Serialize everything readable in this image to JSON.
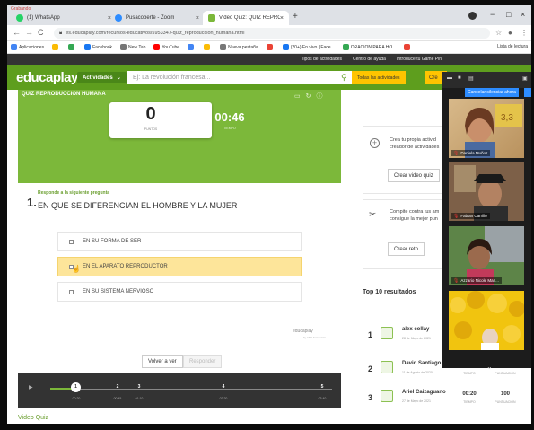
{
  "browser": {
    "recording_label": "Grabando",
    "tabs": [
      {
        "title": "(1) WhatsApp",
        "favicon_color": "#25d366"
      },
      {
        "title": "Pusacoberte - Zoom",
        "favicon_color": "#2d8cff"
      },
      {
        "title": "Video Quiz: QUIZ REPRODUCCIÓN",
        "favicon_color": "#7cb83a"
      }
    ],
    "new_tab": "+",
    "url": "es.educaplay.com/recursos-educativos/5953347-quiz_reproduccion_humana.html",
    "window_controls": [
      "−",
      "□",
      "×"
    ],
    "bookmarks": [
      {
        "label": "Aplicaciones",
        "color": "#4285f4"
      },
      {
        "label": "",
        "color": "#fbbc05"
      },
      {
        "label": "",
        "color": "#34a853"
      },
      {
        "label": "Facebook",
        "color": "#1877f2"
      },
      {
        "label": "New Tab",
        "color": "#777777"
      },
      {
        "label": "YouTube",
        "color": "#ff0000"
      },
      {
        "label": "",
        "color": "#4285f4"
      },
      {
        "label": "",
        "color": "#fbbc05"
      },
      {
        "label": "Nueva pestaña",
        "color": "#777777"
      },
      {
        "label": "",
        "color": "#ea4335"
      },
      {
        "label": "(20+) En vivo | Face...",
        "color": "#1877f2"
      },
      {
        "label": "ORACION PARA HO...",
        "color": "#34a853"
      },
      {
        "label": "",
        "color": "#ea4335"
      }
    ],
    "reading_list": "Lista de lectura"
  },
  "site": {
    "top_links": [
      "Tipos de actividades",
      "Centro de ayuda",
      "Introduce tu Game Pin"
    ],
    "logo": "educaplay",
    "activities_btn": "Actividades",
    "search_placeholder": "Ej: La revolución francesa...",
    "all_activities": "Todas las actividades",
    "create_btn": "Cre",
    "brand_green": "#5e9e1e",
    "accent_yellow": "#ffc400"
  },
  "quiz": {
    "title": "QUIZ REPRODUCCION HUMANA",
    "score": "0",
    "score_label": "PUNTOS",
    "time": "00:46",
    "time_label": "TIEMPO",
    "instruction": "Responde a la siguiente pregunta",
    "question_number": "1.",
    "question": "EN QUE SE DIFERENCIAN EL HOMBRE Y LA MUJER",
    "options": [
      "EN SU FORMA DE SER",
      "EN EL APARATO REPRODUCTOR",
      "EN SU SISTEMA NERVIOSO"
    ],
    "hovered_option": 1,
    "branding": "educaplay",
    "branding_sub": "by ADN Formación",
    "back_btn": "Volver a ver",
    "reply_btn": "Responder",
    "timeline_marks": [
      {
        "label": "1",
        "time": "00:20"
      },
      {
        "label": "2",
        "time": "00:45"
      },
      {
        "label": "3",
        "time": "01:10"
      },
      {
        "label": "4",
        "time": "02:20"
      },
      {
        "label": "5",
        "time": "03:40"
      }
    ],
    "video_quiz_label": "Video Quiz"
  },
  "sidebar": {
    "create_text": "Crea tu propia activid creador de actividades",
    "create_btn": "Crear video quiz",
    "compete_text": "Compite contra tus am consigue la mejor pun",
    "compete_btn": "Crear reto",
    "top10_title": "Top 10 resultados",
    "leaderboard": [
      {
        "rank": "1",
        "name": "alex collay",
        "date": "28 de Mayo de 2021",
        "time": "",
        "score": ""
      },
      {
        "rank": "2",
        "name": "David Santiago",
        "date": "11 de Agosto de 2020",
        "time": "TIEMPO",
        "score": "PUNTUACIÓN"
      },
      {
        "rank": "3",
        "name": "Ariel Caizaguano",
        "date": "27 de Mayo de 2021",
        "time": "00:20",
        "score": "100",
        "time_label": "TIEMPO",
        "score_label": "PUNTUACIÓN"
      }
    ]
  },
  "zoom": {
    "banner": "Cancelar silenciar ahora",
    "more": "...",
    "participants": [
      {
        "name": "Daniela Muñoz",
        "bg": "#c9a66b",
        "muted": true
      },
      {
        "name": "Fabian Carrillo",
        "bg": "#7a5a40",
        "muted": true
      },
      {
        "name": "Azzario Nicole Mari...",
        "bg": "#4c6f3a",
        "muted": true
      },
      {
        "name": "",
        "bg": "#e8b80e",
        "muted": false
      }
    ],
    "participant_counter": "3,3"
  }
}
